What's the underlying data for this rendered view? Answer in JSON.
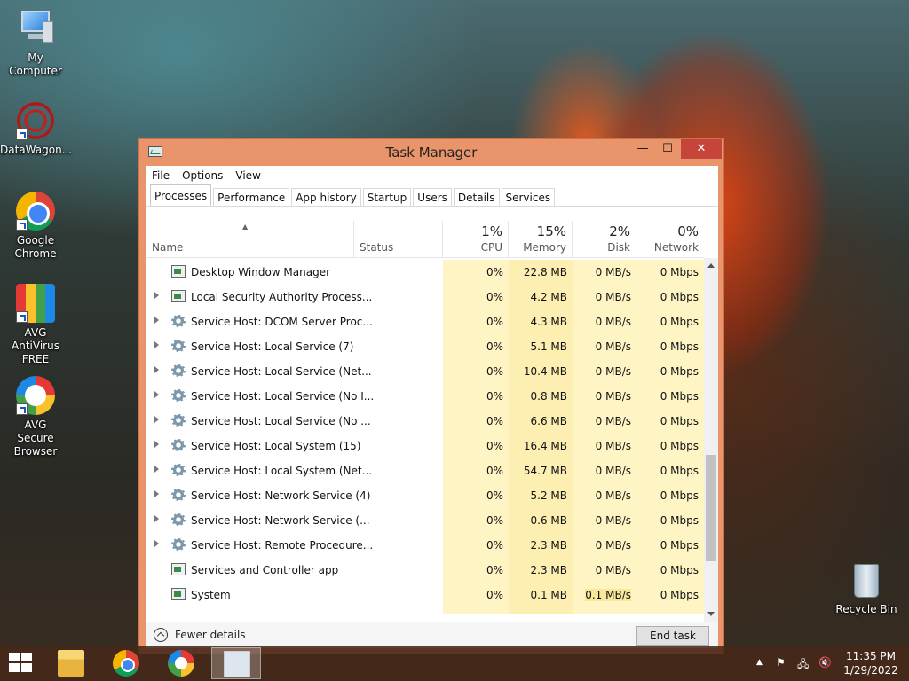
{
  "desktop": {
    "icons": [
      {
        "label": "My Computer"
      },
      {
        "label": "DataWagon..."
      },
      {
        "label": "Google Chrome"
      },
      {
        "label": "AVG AntiVirus FREE"
      },
      {
        "label": "AVG Secure Browser"
      },
      {
        "label": "Recycle Bin"
      }
    ]
  },
  "window": {
    "title": "Task Manager",
    "min_glyph": "—",
    "max_glyph": "☐",
    "close_glyph": "✕"
  },
  "menu": [
    "File",
    "Options",
    "View"
  ],
  "tabs": [
    "Processes",
    "Performance",
    "App history",
    "Startup",
    "Users",
    "Details",
    "Services"
  ],
  "header": {
    "name": "Name",
    "status": "Status",
    "sort_glyph": "▲",
    "cpu": {
      "pct": "1%",
      "label": "CPU"
    },
    "memory": {
      "pct": "15%",
      "label": "Memory"
    },
    "disk": {
      "pct": "2%",
      "label": "Disk"
    },
    "network": {
      "pct": "0%",
      "label": "Network"
    }
  },
  "processes": [
    {
      "name": "Desktop Window Manager",
      "cpu": "0%",
      "memory": "22.8 MB",
      "disk": "0 MB/s",
      "network": "0 Mbps",
      "expandable": false,
      "icon": "window-icon"
    },
    {
      "name": "Local Security Authority Process...",
      "cpu": "0%",
      "memory": "4.2 MB",
      "disk": "0 MB/s",
      "network": "0 Mbps",
      "expandable": true,
      "icon": "window-icon"
    },
    {
      "name": "Service Host: DCOM Server Proc...",
      "cpu": "0%",
      "memory": "4.3 MB",
      "disk": "0 MB/s",
      "network": "0 Mbps",
      "expandable": true,
      "icon": "gear-icon"
    },
    {
      "name": "Service Host: Local Service (7)",
      "cpu": "0%",
      "memory": "5.1 MB",
      "disk": "0 MB/s",
      "network": "0 Mbps",
      "expandable": true,
      "icon": "gear-icon"
    },
    {
      "name": "Service Host: Local Service (Net...",
      "cpu": "0%",
      "memory": "10.4 MB",
      "disk": "0 MB/s",
      "network": "0 Mbps",
      "expandable": true,
      "icon": "gear-icon"
    },
    {
      "name": "Service Host: Local Service (No I...",
      "cpu": "0%",
      "memory": "0.8 MB",
      "disk": "0 MB/s",
      "network": "0 Mbps",
      "expandable": true,
      "icon": "gear-icon"
    },
    {
      "name": "Service Host: Local Service (No ...",
      "cpu": "0%",
      "memory": "6.6 MB",
      "disk": "0 MB/s",
      "network": "0 Mbps",
      "expandable": true,
      "icon": "gear-icon"
    },
    {
      "name": "Service Host: Local System (15)",
      "cpu": "0%",
      "memory": "16.4 MB",
      "disk": "0 MB/s",
      "network": "0 Mbps",
      "expandable": true,
      "icon": "gear-icon"
    },
    {
      "name": "Service Host: Local System (Net...",
      "cpu": "0%",
      "memory": "54.7 MB",
      "disk": "0 MB/s",
      "network": "0 Mbps",
      "expandable": true,
      "icon": "gear-icon"
    },
    {
      "name": "Service Host: Network Service (4)",
      "cpu": "0%",
      "memory": "5.2 MB",
      "disk": "0 MB/s",
      "network": "0 Mbps",
      "expandable": true,
      "icon": "gear-icon"
    },
    {
      "name": "Service Host: Network Service (...",
      "cpu": "0%",
      "memory": "0.6 MB",
      "disk": "0 MB/s",
      "network": "0 Mbps",
      "expandable": true,
      "icon": "gear-icon"
    },
    {
      "name": "Service Host: Remote Procedure...",
      "cpu": "0%",
      "memory": "2.3 MB",
      "disk": "0 MB/s",
      "network": "0 Mbps",
      "expandable": true,
      "icon": "gear-icon"
    },
    {
      "name": "Services and Controller app",
      "cpu": "0%",
      "memory": "2.3 MB",
      "disk": "0 MB/s",
      "network": "0 Mbps",
      "expandable": false,
      "icon": "window-icon"
    },
    {
      "name": "System",
      "cpu": "0%",
      "memory": "0.1 MB",
      "disk": "0.1 MB/s",
      "network": "0 Mbps",
      "expandable": false,
      "icon": "window-icon",
      "disk_highlight": true
    }
  ],
  "footer": {
    "fewer_details": "Fewer details",
    "end_task": "End task"
  },
  "taskbar": {
    "apps": [
      "folder-icon",
      "chrome-icon",
      "avg-browser-icon",
      "task-manager-icon"
    ],
    "tray_arrow": "▲",
    "time": "11:35 PM",
    "date": "1/29/2022"
  }
}
